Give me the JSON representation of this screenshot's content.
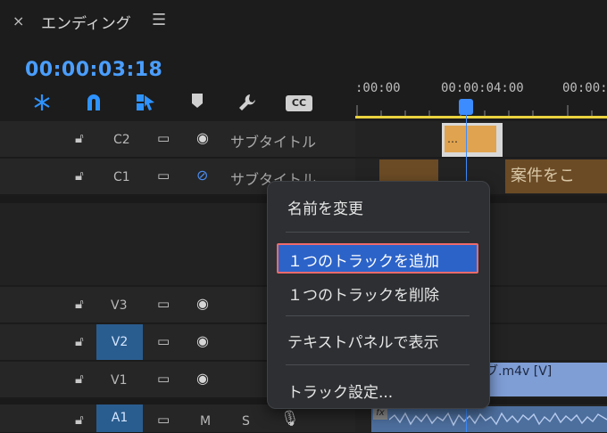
{
  "header": {
    "close_glyph": "×",
    "title": "エンディング",
    "menu_glyph": "☰"
  },
  "timecode": "00:00:03:18",
  "toolbar": {
    "cc_label": "CC"
  },
  "ruler": {
    "labels": [
      ":00:00",
      "00:00:04:00",
      "00:00:"
    ]
  },
  "tracks": {
    "captions": [
      {
        "name": "C2",
        "label": "サブタイトル"
      },
      {
        "name": "C1",
        "label": "サブタイトル"
      }
    ],
    "video": [
      {
        "name": "V3"
      },
      {
        "name": "V2"
      },
      {
        "name": "V1"
      }
    ],
    "audio": [
      {
        "name": "A1",
        "mute": "M",
        "solo": "S"
      }
    ]
  },
  "clips": {
    "c2_clip": "…",
    "c1_clip_text": "案件をこ",
    "v1_clip_text": "ブ.m4v [V]",
    "fx_badge": "fx"
  },
  "context_menu": {
    "items": [
      "名前を変更",
      "１つのトラックを追加",
      "１つのトラックを削除",
      "テキストパネルで表示",
      "トラック設定..."
    ],
    "highlighted_index": 1
  }
}
